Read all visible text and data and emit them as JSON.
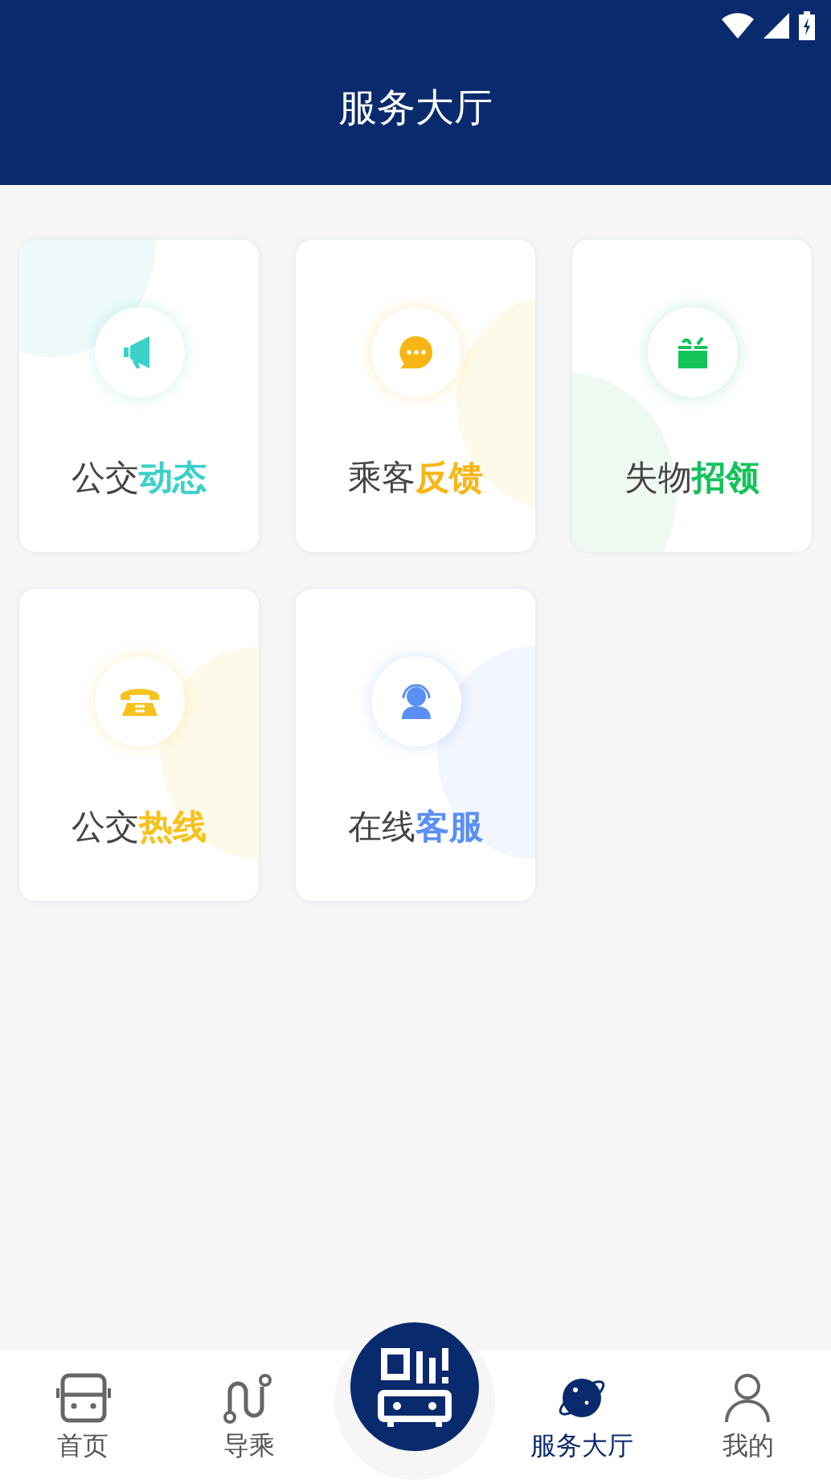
{
  "header": {
    "title": "服务大厅"
  },
  "services": [
    {
      "kind": "news",
      "prefix": "公交",
      "accent": "动态",
      "color": "#3cd0c8"
    },
    {
      "kind": "feedback",
      "prefix": "乘客",
      "accent": "反馈",
      "color": "#f7b614"
    },
    {
      "kind": "lost",
      "prefix": "失物",
      "accent": "招领",
      "color": "#13c35a"
    },
    {
      "kind": "hotline",
      "prefix": "公交",
      "accent": "热线",
      "color": "#f7c21c"
    },
    {
      "kind": "support",
      "prefix": "在线",
      "accent": "客服",
      "color": "#5a8ff5"
    }
  ],
  "tabs": [
    {
      "kind": "bus",
      "label": "首页",
      "selected": false
    },
    {
      "kind": "route",
      "label": "导乘",
      "selected": false
    },
    {
      "kind": "scan",
      "selected": false
    },
    {
      "kind": "service",
      "label": "服务大厅",
      "selected": true
    },
    {
      "kind": "user",
      "label": "我的",
      "selected": false
    }
  ]
}
